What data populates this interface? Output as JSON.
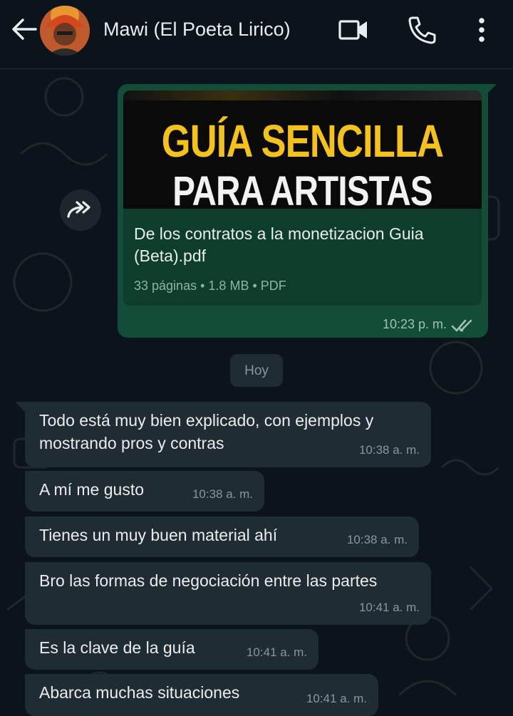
{
  "header": {
    "contact_name": "Mawi (El Poeta Lirico)",
    "icons": [
      "back-arrow-icon",
      "video-call-icon",
      "phone-icon",
      "more-options-icon"
    ]
  },
  "outgoing": {
    "thumbnail": {
      "line1": "GUÍA SENCILLA",
      "line2": "PARA ARTISTAS"
    },
    "file_name": "De los contratos a la monetizacion Guia (Beta).pdf",
    "pages": "33 páginas",
    "size": "1.8 MB",
    "type": "PDF",
    "separator": "•",
    "time": "10:23 p. m.",
    "status": "read"
  },
  "date_chip": "Hoy",
  "incoming": [
    {
      "text": "Todo está muy bien explicado, con ejemplos y mostrando pros y contras",
      "time": "10:38 a. m."
    },
    {
      "text": "A mí me gusto",
      "time": "10:38 a. m."
    },
    {
      "text": "Tienes un muy buen material ahí",
      "time": "10:38 a. m."
    },
    {
      "text": "Bro las formas de negociación entre las partes",
      "time": "10:41 a. m."
    },
    {
      "text": "Es la clave de la guía",
      "time": "10:41 a. m."
    },
    {
      "text": "Abarca muchas situaciones",
      "time": "10:41 a. m."
    }
  ],
  "colors": {
    "background": "#0b141a",
    "outgoing_bubble": "#134d37",
    "incoming_bubble": "#202c33",
    "thumbnail_title_yellow": "#f5c21a",
    "read_ticks": "#9ec3b4"
  }
}
